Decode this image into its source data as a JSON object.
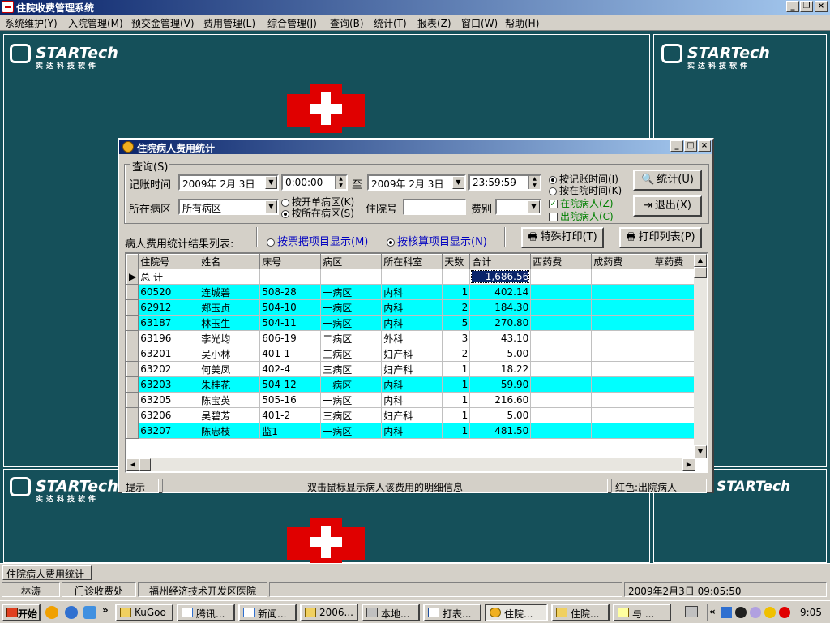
{
  "app": {
    "title": "住院收费管理系统"
  },
  "menu": [
    "系统维护(Y)",
    "入院管理(M)",
    "预交金管理(V)",
    "费用管理(L)",
    "综合管理(J)",
    "查询(B)",
    "统计(T)",
    "报表(Z)",
    "窗口(W)",
    "帮助(H)"
  ],
  "desktop": {
    "logo_text": "STARTech",
    "logo_sub": "实达科技软件"
  },
  "dialog": {
    "title": "住院病人费用统计",
    "query_group": "查询(S)",
    "date_label": "记账时间",
    "date_from": "2009年 2月 3日",
    "time_from": "0:00:00",
    "to_label": "至",
    "date_to": "2009年 2月 3日",
    "time_to": "23:59:59",
    "radio_by_account_time": "按记账时间(I)",
    "radio_by_stay_time": "按在院时间(K)",
    "ward_label": "所在病区",
    "ward_value": "所有病区",
    "radio_open_ward": "按开单病区(K)",
    "radio_in_ward": "按所在病区(S)",
    "inpatient_no_label": "住院号",
    "inpatient_no_value": "",
    "fee_label": "费别",
    "fee_value": "",
    "chk_in_hospital": "在院病人(Z)",
    "chk_discharged": "出院病人(C)",
    "btn_stat": "统计(U)",
    "btn_exit": "退出(X)",
    "result_label": "病人费用统计结果列表:",
    "radio_by_receipt": "按票据项目显示(M)",
    "radio_by_accounting": "按核算项目显示(N)",
    "btn_special_print": "特殊打印(T)",
    "btn_print_list": "打印列表(P)",
    "status_hint": "提示",
    "status_msg": "双击鼠标显示病人该费用的明细信息",
    "status_legend": "红色:出院病人"
  },
  "grid": {
    "columns": [
      "住院号",
      "姓名",
      "床号",
      "病区",
      "所在科室",
      "天数",
      "合计",
      "西药费",
      "成药费",
      "草药费"
    ],
    "total_label": "总 计",
    "total_value": "1,686.56",
    "rows": [
      {
        "id": "60520",
        "name": "连城碧",
        "bed": "508-28",
        "ward": "一病区",
        "dept": "内科",
        "days": "1",
        "total": "402.14",
        "hl": true
      },
      {
        "id": "62912",
        "name": "郑玉贞",
        "bed": "504-10",
        "ward": "一病区",
        "dept": "内科",
        "days": "2",
        "total": "184.30",
        "hl": true
      },
      {
        "id": "63187",
        "name": "林玉生",
        "bed": "504-11",
        "ward": "一病区",
        "dept": "内科",
        "days": "5",
        "total": "270.80",
        "hl": true
      },
      {
        "id": "63196",
        "name": "李光均",
        "bed": "606-19",
        "ward": "二病区",
        "dept": "外科",
        "days": "3",
        "total": "43.10",
        "hl": false
      },
      {
        "id": "63201",
        "name": "吴小林",
        "bed": "401-1",
        "ward": "三病区",
        "dept": "妇产科",
        "days": "2",
        "total": "5.00",
        "hl": false
      },
      {
        "id": "63202",
        "name": "何美凤",
        "bed": "402-4",
        "ward": "三病区",
        "dept": "妇产科",
        "days": "1",
        "total": "18.22",
        "hl": false
      },
      {
        "id": "63203",
        "name": "朱桂花",
        "bed": "504-12",
        "ward": "一病区",
        "dept": "内科",
        "days": "1",
        "total": "59.90",
        "hl": true
      },
      {
        "id": "63205",
        "name": "陈宝英",
        "bed": "505-16",
        "ward": "一病区",
        "dept": "内科",
        "days": "1",
        "total": "216.60",
        "hl": false
      },
      {
        "id": "63206",
        "name": "吴碧芳",
        "bed": "401-2",
        "ward": "三病区",
        "dept": "妇产科",
        "days": "1",
        "total": "5.00",
        "hl": false
      },
      {
        "id": "63207",
        "name": "陈忠枝",
        "bed": "监1",
        "ward": "一病区",
        "dept": "内科",
        "days": "1",
        "total": "481.50",
        "hl": true
      }
    ]
  },
  "mdi_tab": "住院病人费用统计",
  "statusbar": {
    "user": "林涛",
    "dept": "门诊收费处",
    "org": "福州经济技术开发区医院",
    "datetime": "2009年2月3日 09:05:50"
  },
  "taskbar": {
    "start": "开始",
    "items": [
      "KuGoo",
      "腾讯...",
      "新闻...",
      "2006...",
      "本地...",
      "打表...",
      "住院...",
      "住院...",
      "与 ..."
    ],
    "clock": "9:05"
  },
  "colors": {
    "highlight_row": "#00ffff",
    "desktop_bg": "#15505a",
    "title_bar": "#0a246a"
  }
}
